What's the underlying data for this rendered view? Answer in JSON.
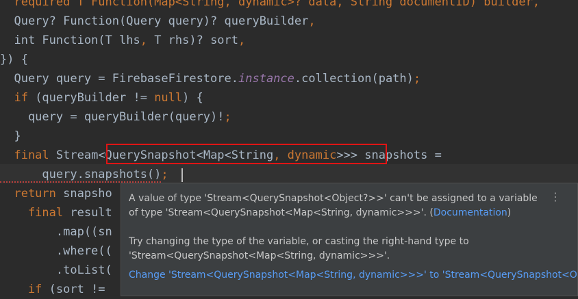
{
  "code": {
    "l0": "  required T Function(Map<String, dynamic>? data, String documentID) builder,",
    "l1_a": "  Query? Function(Query query)? queryBuilder",
    "l1_b": ",",
    "l2_a": "  int Function(T lhs",
    "l2_b": ", ",
    "l2_c": "T rhs)? sort",
    "l2_d": ",",
    "l3": "}) {",
    "l4_a": "  Query query = FirebaseFirestore.",
    "l4_b": "instance",
    "l4_c": ".collection(path)",
    "l4_d": ";",
    "l5_a": "  if",
    "l5_b": " (queryBuilder != ",
    "l5_c": "null",
    "l5_d": ") {",
    "l6_a": "    query = queryBuilder(query)!",
    "l6_b": ";",
    "l7": "  }",
    "l8_a": "  final",
    "l8_b": " Stream",
    "l8_c": "<QuerySnapshot<Map<String",
    "l8_d": ", ",
    "l8_e": "dynamic",
    "l8_f": ">>>",
    "l8_g": " snapshots =",
    "l9_a": "      query.snapshots()",
    "l9_b": ";",
    "l10_a": "  return",
    "l10_b": " snapsho",
    "l11_a": "    final",
    "l11_b": " result",
    "l12": "        .map((sn",
    "l13": "        .where((",
    "l14": "        .toList(",
    "l15_a": "    if",
    "l15_b": " (sort !="
  },
  "popup": {
    "msg1": "A value of type 'Stream<QuerySnapshot<Object?>>' can't be assigned to a variable of type 'Stream<QuerySnapshot<Map<String, dynamic>>>'. (",
    "doc_link": "Documentation",
    "msg1_end": ")",
    "msg2": "Try changing the type of the variable, or casting the right-hand type to 'Stream<QuerySnapshot<Map<String, dynamic>>>'.",
    "fix": "Change 'Stream<QuerySnapshot<Map<String, dynamic>>>' to 'Stream<QuerySnapshot<Object?",
    "more_icon": "⋮"
  },
  "colors": {
    "keyword": "#cc7832",
    "text": "#a9b7c6",
    "static": "#9876aa",
    "error": "#e01414",
    "link": "#589df6"
  }
}
